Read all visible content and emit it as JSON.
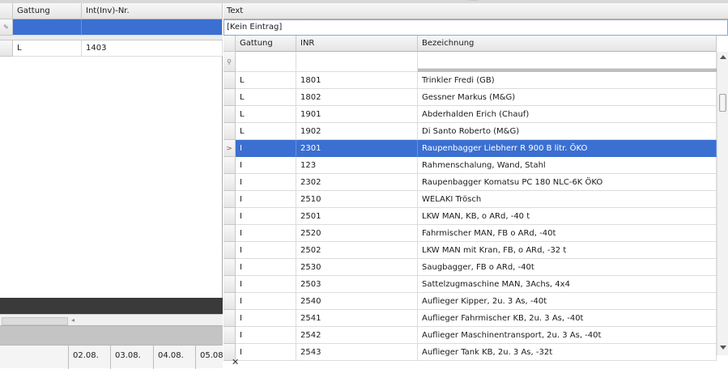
{
  "left_grid": {
    "columns": [
      "Gattung",
      "Int(Inv)-Nr."
    ],
    "rows": [
      {
        "gattung": "L",
        "nr": "1403"
      }
    ]
  },
  "timeline": {
    "dates": [
      "02.08.",
      "03.08.",
      "04.08.",
      "05.08"
    ]
  },
  "right_panel": {
    "title": "Text",
    "combo_value": "[Kein Eintrag]",
    "columns": [
      "Gattung",
      "INR",
      "Bezeichnung"
    ],
    "selected_index": 4,
    "rows": [
      {
        "gattung": "L",
        "inr": "1801",
        "bez": "Trinkler Fredi (GB)"
      },
      {
        "gattung": "L",
        "inr": "1802",
        "bez": "Gessner Markus (M&G)"
      },
      {
        "gattung": "L",
        "inr": "1901",
        "bez": "Abderhalden Erich (Chauf)"
      },
      {
        "gattung": "L",
        "inr": "1902",
        "bez": "Di Santo Roberto (M&G)"
      },
      {
        "gattung": "I",
        "inr": "2301",
        "bez": "Raupenbagger Liebherr R 900 B litr. ÖKO"
      },
      {
        "gattung": "I",
        "inr": "123",
        "bez": "Rahmenschalung, Wand, Stahl"
      },
      {
        "gattung": "I",
        "inr": "2302",
        "bez": "Raupenbagger Komatsu PC 180 NLC-6K ÖKO"
      },
      {
        "gattung": "I",
        "inr": "2510",
        "bez": "WELAKI Trösch"
      },
      {
        "gattung": "I",
        "inr": "2501",
        "bez": "LKW MAN, KB, o ARd, -40 t"
      },
      {
        "gattung": "I",
        "inr": "2520",
        "bez": "Fahrmischer MAN, FB o ARd, -40t"
      },
      {
        "gattung": "I",
        "inr": "2502",
        "bez": "LKW MAN mit Kran, FB, o ARd, -32 t"
      },
      {
        "gattung": "I",
        "inr": "2530",
        "bez": "Saugbagger, FB o ARd, -40t"
      },
      {
        "gattung": "I",
        "inr": "2503",
        "bez": "Sattelzugmaschine MAN, 3Achs, 4x4"
      },
      {
        "gattung": "I",
        "inr": "2540",
        "bez": "Auflieger Kipper, 2u. 3 As, -40t"
      },
      {
        "gattung": "I",
        "inr": "2541",
        "bez": "Auflieger Fahrmischer KB, 2u. 3 As, -40t"
      },
      {
        "gattung": "I",
        "inr": "2542",
        "bez": "Auflieger Maschinentransport, 2u. 3 As, -40t"
      },
      {
        "gattung": "I",
        "inr": "2543",
        "bez": "Auflieger Tank KB, 2u. 3 As, -32t"
      }
    ]
  },
  "icons": {
    "edit_row": "pencil-icon",
    "filter_row": "filter-icon",
    "current_row": "row-arrow-icon",
    "close": "close-icon"
  },
  "colors": {
    "selection": "#3b6fd1",
    "dark_bar": "#3a3a3a"
  }
}
